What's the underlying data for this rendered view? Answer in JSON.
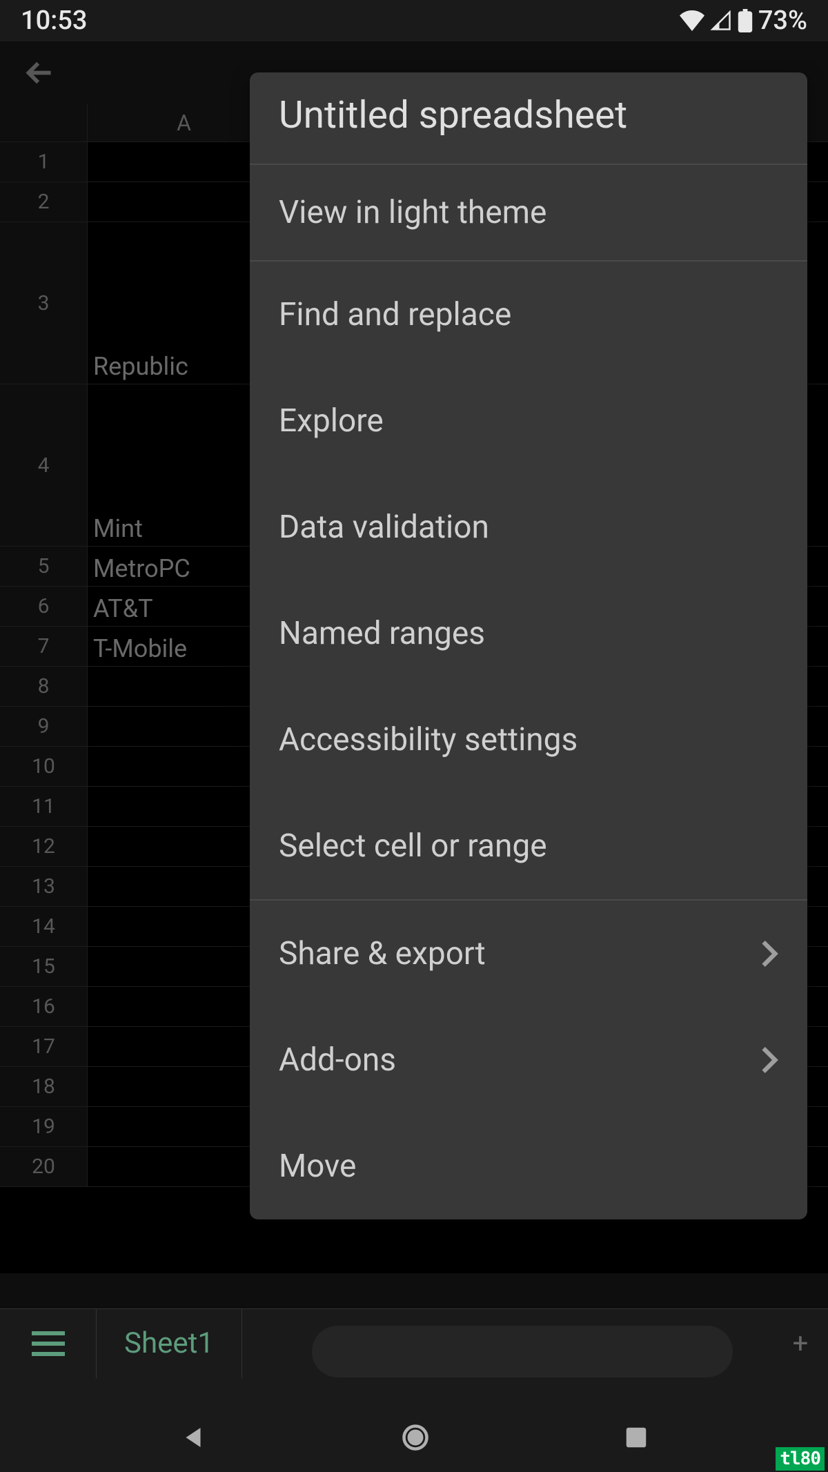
{
  "status_bar": {
    "time": "10:53",
    "battery_percent": "73%"
  },
  "spreadsheet": {
    "columns": [
      "A"
    ],
    "rows": [
      {
        "num": "1",
        "a": ""
      },
      {
        "num": "2",
        "a": ""
      },
      {
        "num": "3",
        "a": "Republic"
      },
      {
        "num": "4",
        "a": "Mint"
      },
      {
        "num": "5",
        "a": "MetroPC"
      },
      {
        "num": "6",
        "a": "AT&T"
      },
      {
        "num": "7",
        "a": "T-Mobile"
      },
      {
        "num": "8",
        "a": ""
      },
      {
        "num": "9",
        "a": ""
      },
      {
        "num": "10",
        "a": ""
      },
      {
        "num": "11",
        "a": ""
      },
      {
        "num": "12",
        "a": ""
      },
      {
        "num": "13",
        "a": ""
      },
      {
        "num": "14",
        "a": ""
      },
      {
        "num": "15",
        "a": ""
      },
      {
        "num": "16",
        "a": ""
      },
      {
        "num": "17",
        "a": ""
      },
      {
        "num": "18",
        "a": ""
      },
      {
        "num": "19",
        "a": ""
      },
      {
        "num": "20",
        "a": ""
      }
    ]
  },
  "sheet_tabs": {
    "active": "Sheet1"
  },
  "menu": {
    "title": "Untitled spreadsheet",
    "view_light": "View in light theme",
    "find_replace": "Find and replace",
    "explore": "Explore",
    "data_validation": "Data validation",
    "named_ranges": "Named ranges",
    "accessibility": "Accessibility settings",
    "select_cell": "Select cell or range",
    "share_export": "Share & export",
    "addons": "Add-ons",
    "move": "Move"
  },
  "watermark": "tl80"
}
